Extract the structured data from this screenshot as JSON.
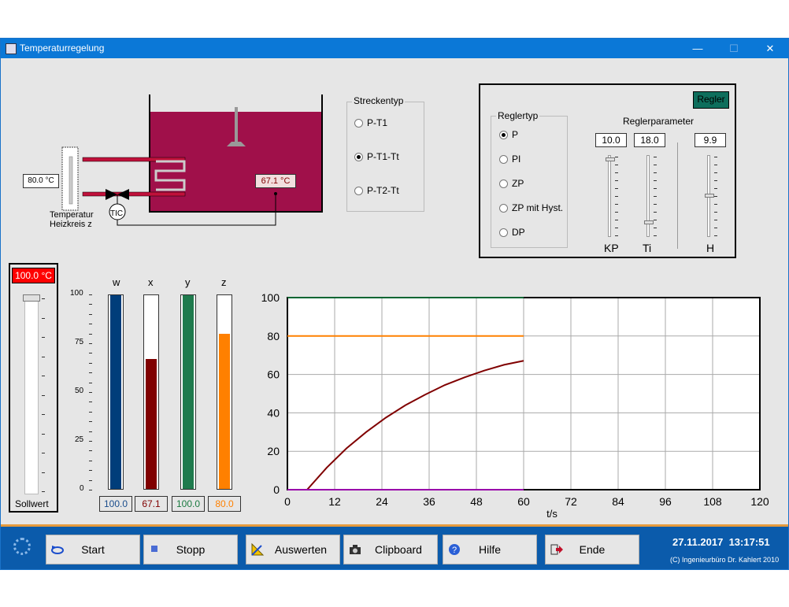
{
  "window": {
    "title": "Temperaturregelung",
    "min": "—",
    "max": "☐",
    "close": "✕"
  },
  "plant": {
    "heater_temp": "80.0 °C",
    "heater_label_1": "Temperatur",
    "heater_label_2": "Heizkreis z",
    "tank_temp": "67.1 °C",
    "controller_tag": "TIC"
  },
  "streckentyp": {
    "title": "Streckentyp",
    "options": [
      "P-T1",
      "P-T1-Tt",
      "P-T2-Tt"
    ],
    "selected": 1
  },
  "regler": {
    "button": "Regler",
    "typ_title": "Reglertyp",
    "types": [
      "P",
      "PI",
      "ZP",
      "ZP mit Hyst.",
      "DP"
    ],
    "selected": 0,
    "param_title": "Reglerparameter",
    "params": [
      {
        "name": "KP",
        "value": "10.0",
        "level": 0.97
      },
      {
        "name": "Ti",
        "value": "18.0",
        "level": 0.15
      },
      {
        "name": "H",
        "value": "9.9",
        "level": 0.5
      }
    ]
  },
  "sollwert": {
    "value": "100.0 °C",
    "label": "Sollwert",
    "level": 1.0,
    "color": "#ff0000"
  },
  "bars": {
    "axis": [
      "100",
      "75",
      "50",
      "25",
      "0"
    ],
    "items": [
      {
        "name": "w",
        "value": "100.0",
        "level": 100,
        "color": "#003d7a",
        "text_color": "#1a4d8c"
      },
      {
        "name": "x",
        "value": "67.1",
        "level": 67.1,
        "color": "#800000",
        "text_color": "#800000"
      },
      {
        "name": "y",
        "value": "100.0",
        "level": 100,
        "color": "#1f7a4d",
        "text_color": "#1a7a40"
      },
      {
        "name": "z",
        "value": "80.0",
        "level": 80,
        "color": "#ff8000",
        "text_color": "#ff8000"
      }
    ]
  },
  "chart_data": {
    "type": "line",
    "xlabel": "t/s",
    "ylabel": "",
    "xlim": [
      0,
      120
    ],
    "ylim": [
      0,
      100
    ],
    "xticks": [
      0,
      12,
      24,
      36,
      48,
      60,
      72,
      84,
      96,
      108,
      120
    ],
    "yticks": [
      0,
      20,
      40,
      60,
      80,
      100
    ],
    "grid": true,
    "series": [
      {
        "color": "#006633",
        "x": [
          0,
          60
        ],
        "y": [
          100,
          100
        ]
      },
      {
        "color": "#ff8000",
        "x": [
          0,
          60
        ],
        "y": [
          80,
          80
        ]
      },
      {
        "color": "#800000",
        "x": [
          0,
          5,
          10,
          15,
          20,
          25,
          30,
          35,
          40,
          45,
          50,
          55,
          60
        ],
        "y": [
          0,
          0,
          11.5,
          21.5,
          30,
          37.5,
          44,
          49.5,
          54.5,
          58.5,
          62,
          65,
          67.1
        ]
      },
      {
        "color": "#9900aa",
        "x": [
          0,
          60
        ],
        "y": [
          0,
          0
        ]
      }
    ]
  },
  "toolbar": {
    "start": "Start",
    "stopp": "Stopp",
    "auswerten": "Auswerten",
    "clipboard": "Clipboard",
    "hilfe": "Hilfe",
    "ende": "Ende"
  },
  "status": {
    "datetime": "27.11.2017  13:17:51",
    "copyright": "(C) Ingenieurbüro Dr. Kahlert 2010"
  }
}
